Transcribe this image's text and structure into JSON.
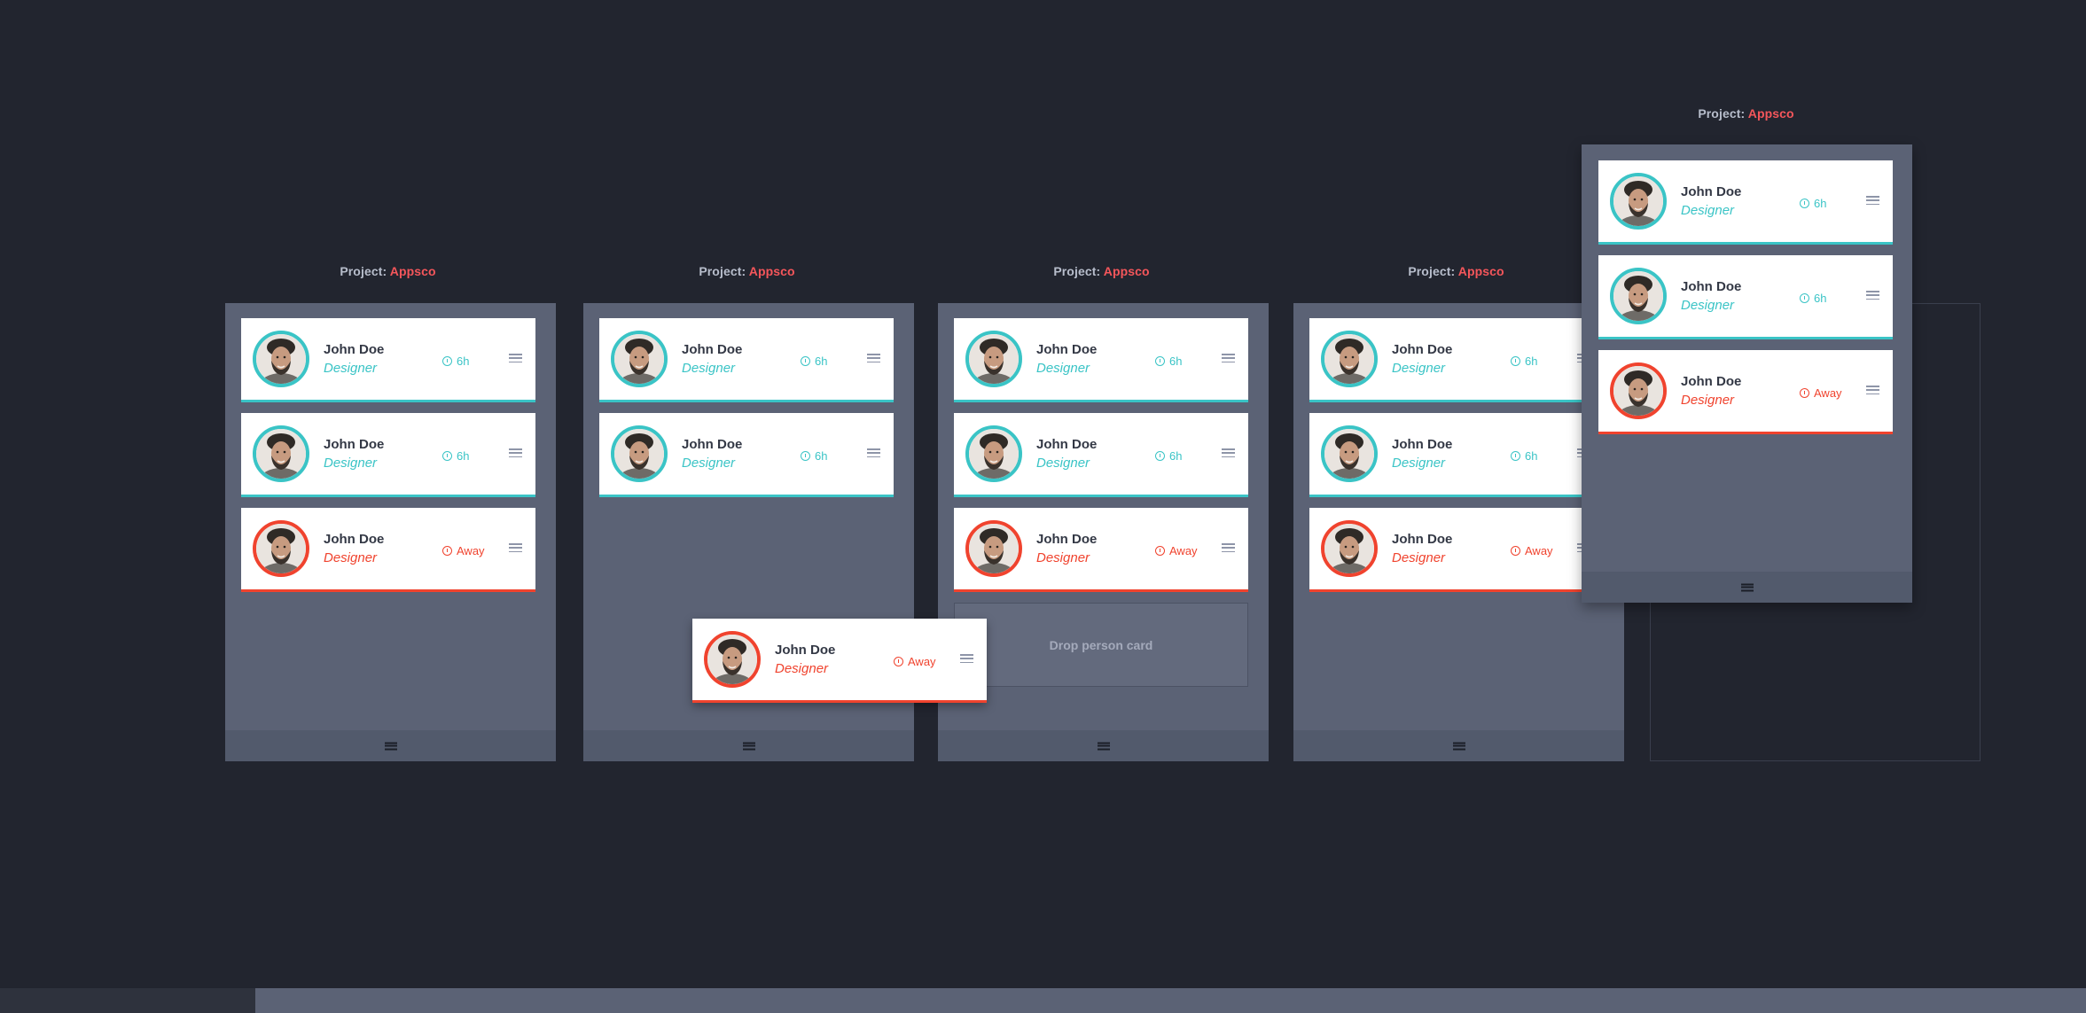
{
  "project_label": "Project:",
  "project_name": "Appsco",
  "drop_zone_label": "Drop person card",
  "colors": {
    "background": "#22252f",
    "column": "#5b6275",
    "active_teal": "#3ac4c6",
    "away_red": "#f0432e",
    "project_accent": "#f5565b"
  },
  "person": {
    "name": "John Doe",
    "role": "Designer",
    "hours": "6h",
    "away": "Away"
  },
  "icons": {
    "status": "clock-icon",
    "drag": "drag-handle-icon",
    "column_menu": "menu-icon"
  }
}
